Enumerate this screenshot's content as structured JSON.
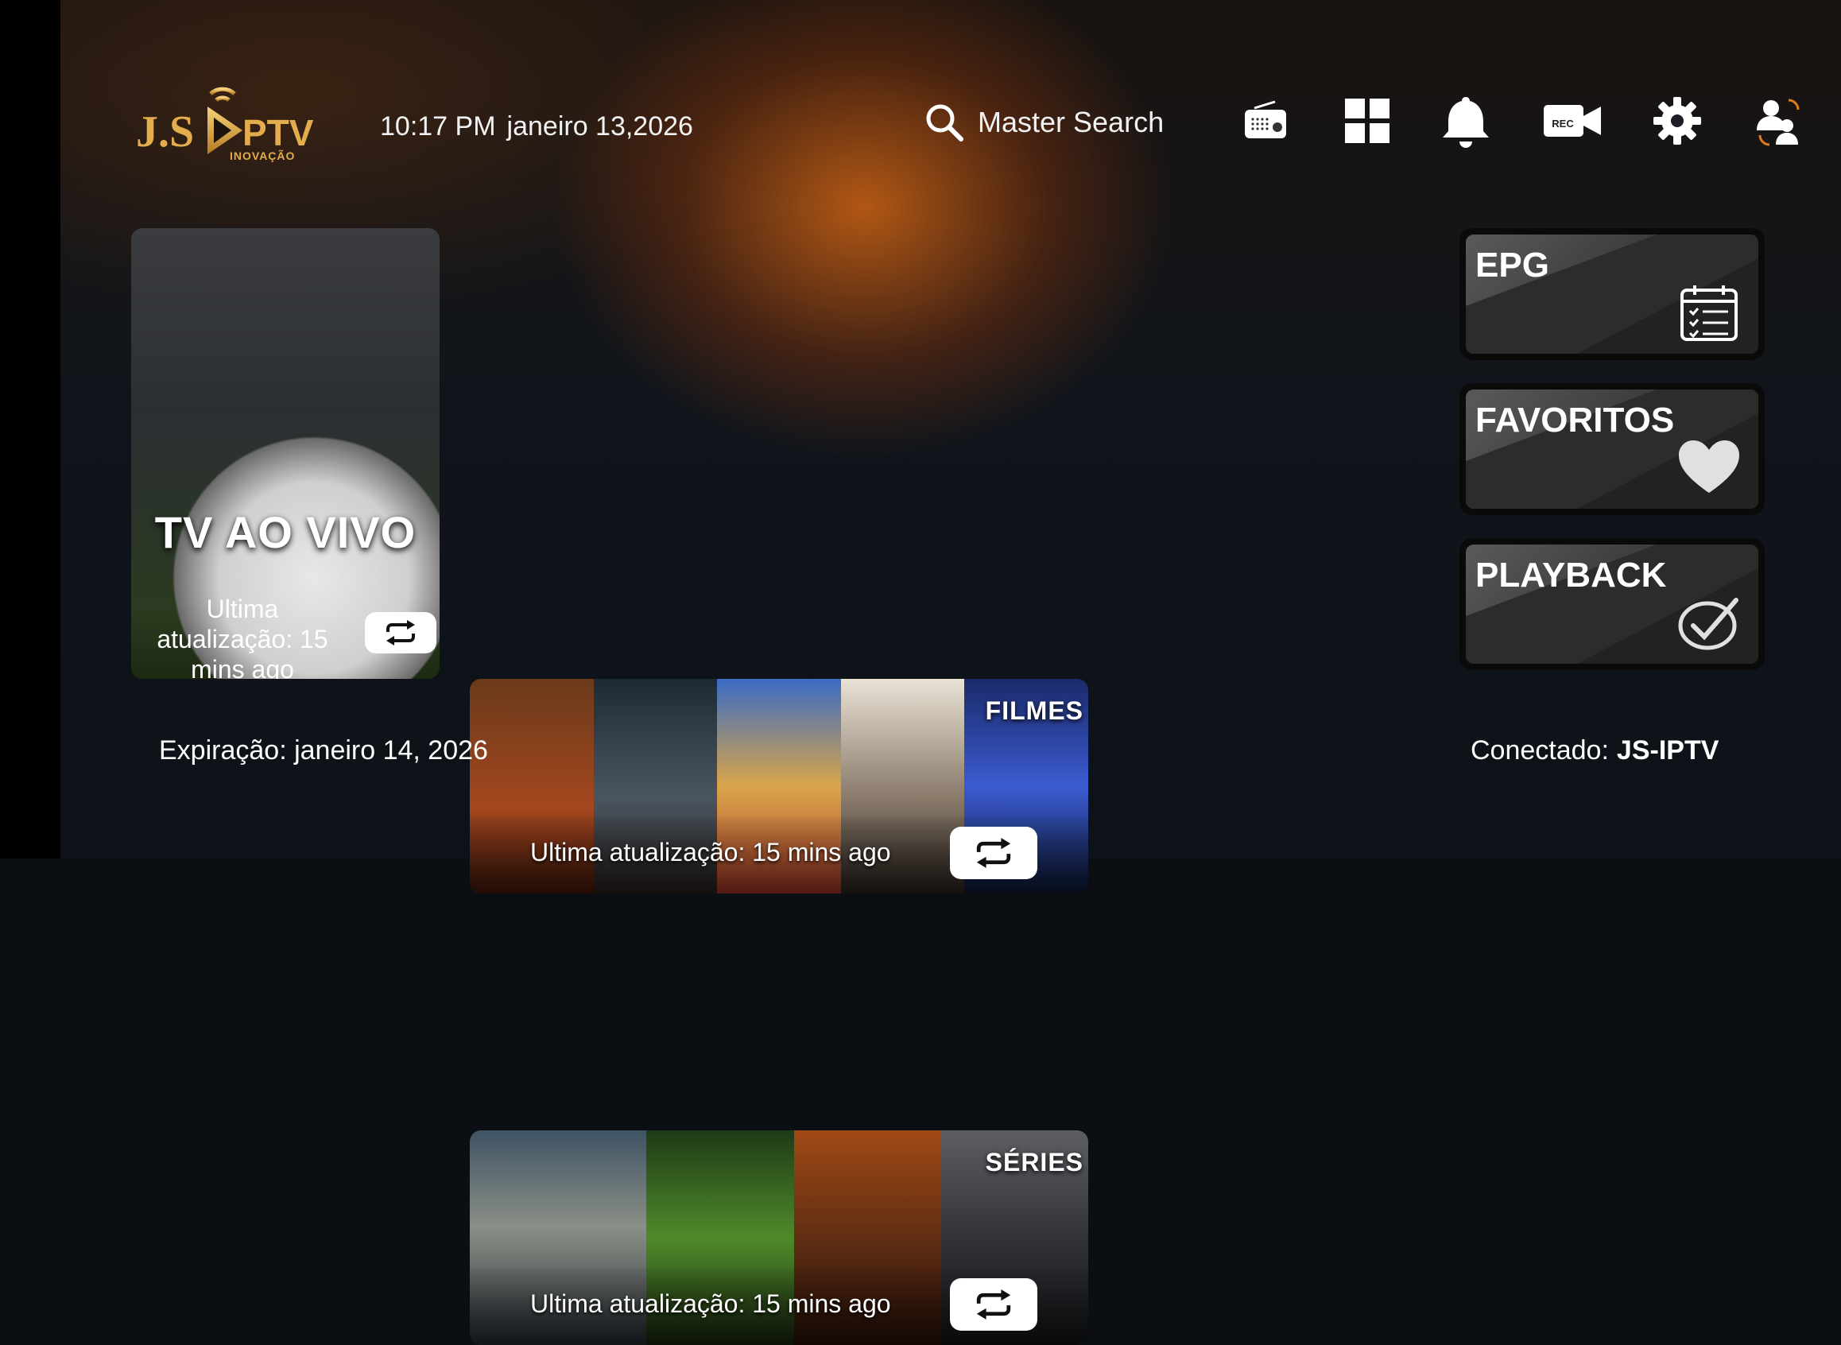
{
  "brand": {
    "logo_text": "J.S",
    "logo_suffix": "PTV",
    "logo_tagline": "INOVAÇÃO"
  },
  "header": {
    "time": "10:17 PM",
    "date": "janeiro 13,2026",
    "search_label": "Master Search",
    "icons": [
      "radio-icon",
      "grid-icon",
      "bell-icon",
      "rec-icon",
      "gear-icon",
      "switch-user-icon"
    ],
    "rec_text": "REC"
  },
  "cards": {
    "live": {
      "title": "TV AO VIVO",
      "update": "Ultima atualização: 15 mins ago"
    },
    "movies": {
      "label": "FILMES",
      "update": "Ultima atualização: 15 mins ago"
    },
    "series": {
      "label": "SÉRIES",
      "update": "Ultima atualização: 15 mins ago"
    }
  },
  "side": {
    "epg": "EPG",
    "favorites": "FAVORITOS",
    "playback": "PLAYBACK"
  },
  "footer": {
    "expiration": "Expiração: janeiro 14, 2026",
    "connected_label": "Conectado:",
    "connected_value": "JS-IPTV"
  },
  "colors": {
    "accent": "#e07a1a",
    "gold": "#d9a23a",
    "white": "#ffffff"
  }
}
